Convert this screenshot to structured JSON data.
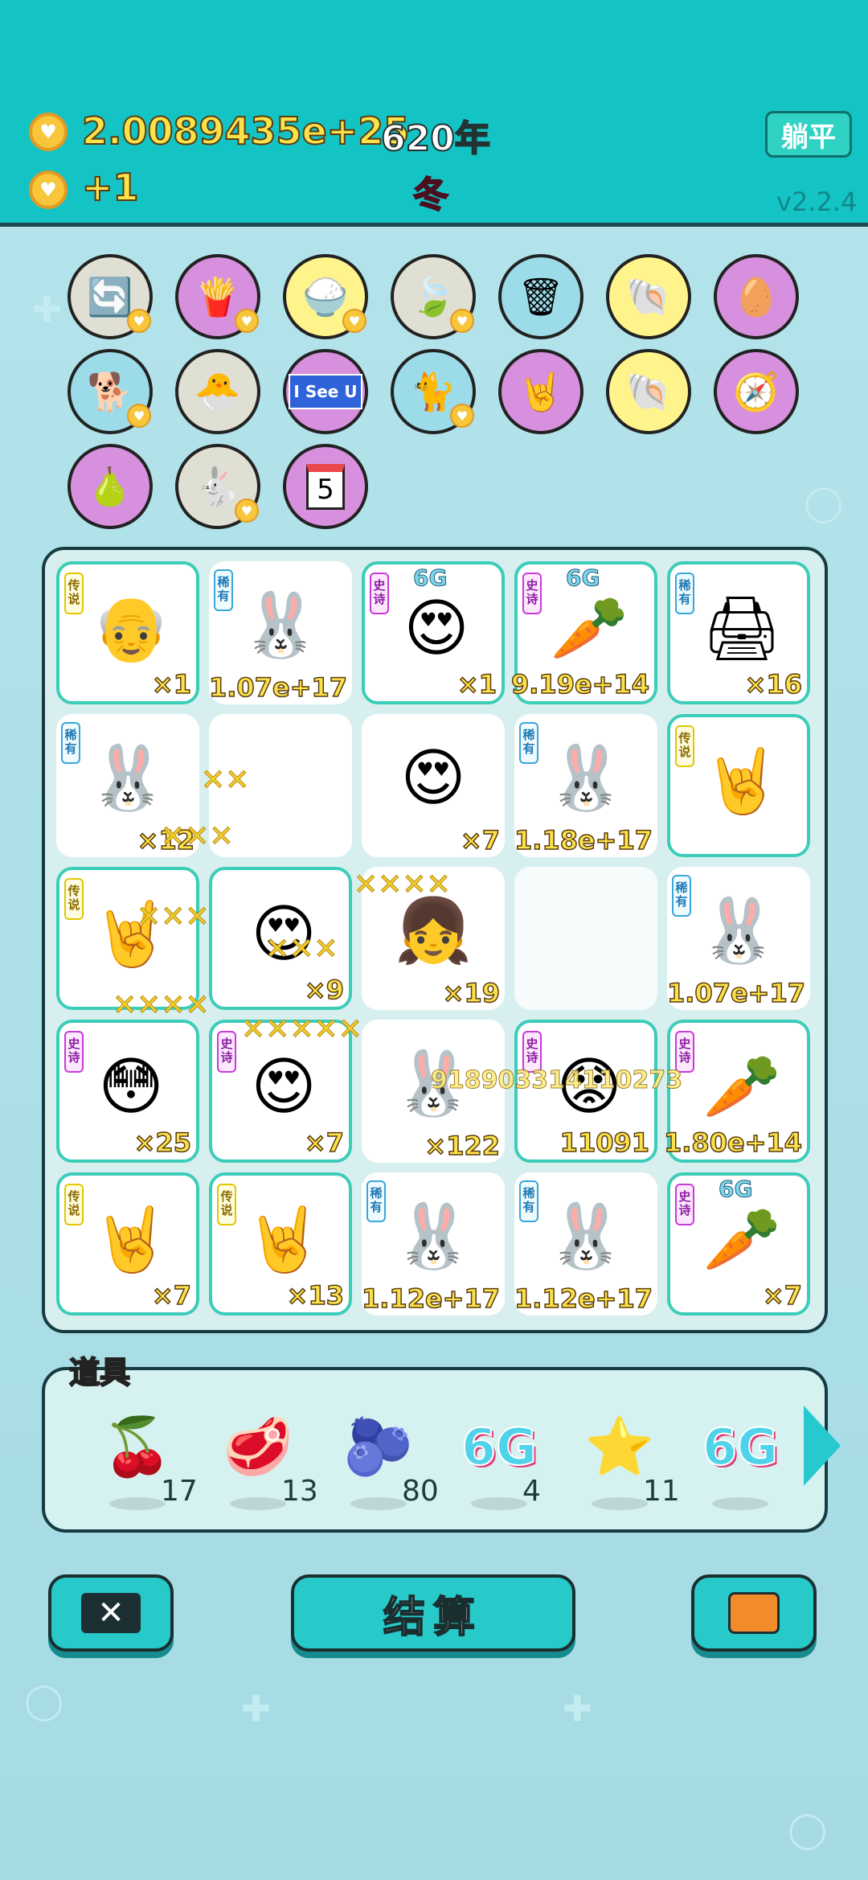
{
  "header": {
    "coins": "2.0089435e+25",
    "year": "620年",
    "rate": "+1",
    "season": "冬",
    "lie_flat_label": "躺平",
    "version": "v2.2.4"
  },
  "collection": [
    {
      "icon": "refresh-icon",
      "glyph": "🔄",
      "bg": "gray",
      "badge": true
    },
    {
      "icon": "fries-icon",
      "glyph": "🍟",
      "bg": "purple",
      "badge": true
    },
    {
      "icon": "rice-bowl-icon",
      "glyph": "🍚",
      "bg": "yellow",
      "badge": true
    },
    {
      "icon": "leaf-icon",
      "glyph": "🍃",
      "bg": "gray",
      "badge": true
    },
    {
      "icon": "trash-bag-icon",
      "glyph": "🗑",
      "bg": "blue",
      "badge": false
    },
    {
      "icon": "shell-icon",
      "glyph": "🐚",
      "bg": "yellow",
      "badge": false
    },
    {
      "icon": "egg-icon",
      "glyph": "🥚",
      "bg": "purple",
      "badge": false
    },
    {
      "icon": "dog-icon",
      "glyph": "🐕",
      "bg": "blue",
      "badge": true
    },
    {
      "icon": "chick-icon",
      "glyph": "🐣",
      "bg": "gray",
      "badge": false
    },
    {
      "icon": "i-see-u-sign-icon",
      "glyph": "I See U",
      "bg": "purple",
      "badge": false
    },
    {
      "icon": "cat-icon",
      "glyph": "🐈",
      "bg": "blue",
      "badge": true
    },
    {
      "icon": "rock-hand-icon",
      "glyph": "🤘",
      "bg": "purple",
      "badge": false
    },
    {
      "icon": "shell-icon",
      "glyph": "🐚",
      "bg": "yellow",
      "badge": false
    },
    {
      "icon": "compass-icon",
      "glyph": "🧭",
      "bg": "purple",
      "badge": false
    },
    {
      "icon": "grapefruit-icon",
      "glyph": "🍐",
      "bg": "purple",
      "badge": false
    },
    {
      "icon": "rabbit-icon",
      "glyph": "🐇",
      "bg": "gray",
      "badge": true
    },
    {
      "icon": "calendar-icon",
      "glyph": "5",
      "bg": "purple",
      "badge": false
    }
  ],
  "board": [
    {
      "tag": "传说",
      "tagType": "cs",
      "icon": "old-man-glasses-icon",
      "glyph": "👴",
      "count": "×1",
      "rare": true
    },
    {
      "tag": "稀有",
      "tagType": "xy",
      "icon": "rabbit-icon",
      "glyph": "🐰",
      "count": "1.07e+17",
      "rare": false
    },
    {
      "tag": "史诗",
      "tagType": "ss",
      "icon": "heart-eyes-face-icon",
      "glyph": "😍",
      "count": "×1",
      "rare": true,
      "top": "6G"
    },
    {
      "tag": "史诗",
      "tagType": "ss",
      "icon": "carrot-icon",
      "glyph": "🥕",
      "count": "9.19e+14",
      "rare": true,
      "top": "6G"
    },
    {
      "tag": "稀有",
      "tagType": "xy",
      "icon": "printer-icon",
      "glyph": "🖨",
      "count": "×16",
      "rare": true
    },
    {
      "tag": "稀有",
      "tagType": "xy",
      "icon": "rabbit-icon",
      "glyph": "🐰",
      "count": "×12",
      "rare": false
    },
    {
      "tag": "",
      "tagType": "",
      "icon": "sparkle-icon",
      "glyph": "",
      "count": "",
      "rare": false
    },
    {
      "tag": "",
      "tagType": "",
      "icon": "heart-eyes-man-icon",
      "glyph": "😍",
      "count": "×7",
      "rare": false
    },
    {
      "tag": "稀有",
      "tagType": "xy",
      "icon": "rabbit-icon",
      "glyph": "🐰",
      "count": "1.18e+17",
      "rare": false
    },
    {
      "tag": "传说",
      "tagType": "cs",
      "icon": "rock-hand-icon",
      "glyph": "🤘",
      "count": "",
      "rare": true
    },
    {
      "tag": "传说",
      "tagType": "cs",
      "icon": "rock-hand-icon",
      "glyph": "🤘",
      "count": "",
      "rare": true
    },
    {
      "tag": "",
      "tagType": "",
      "icon": "green-hat-face-icon",
      "glyph": "😍",
      "count": "×9",
      "rare": true
    },
    {
      "tag": "",
      "tagType": "",
      "icon": "girl-face-icon",
      "glyph": "👧",
      "count": "×19",
      "rare": false
    },
    {
      "tag": "",
      "tagType": "",
      "icon": "empty-slot",
      "glyph": "",
      "count": "",
      "rare": false
    },
    {
      "tag": "稀有",
      "tagType": "xy",
      "icon": "rabbit-icon",
      "glyph": "🐰",
      "count": "1.07e+17",
      "rare": false
    },
    {
      "tag": "史诗",
      "tagType": "ss",
      "icon": "blush-girl-icon",
      "glyph": "😳",
      "count": "×25",
      "rare": true
    },
    {
      "tag": "史诗",
      "tagType": "ss",
      "icon": "heart-eyes-girl-icon",
      "glyph": "😍",
      "count": "×7",
      "rare": true
    },
    {
      "tag": "",
      "tagType": "",
      "icon": "rabbit-icon",
      "glyph": "🐰",
      "count": "×122",
      "rare": false
    },
    {
      "tag": "史诗",
      "tagType": "ss",
      "icon": "sad-old-man-icon",
      "glyph": "😟",
      "count": "11091",
      "rare": true
    },
    {
      "tag": "史诗",
      "tagType": "ss",
      "icon": "carrot-icon",
      "glyph": "🥕",
      "count": "1.80e+14",
      "rare": true
    },
    {
      "tag": "传说",
      "tagType": "cs",
      "icon": "rock-hand-icon",
      "glyph": "🤘",
      "count": "×7",
      "rare": true
    },
    {
      "tag": "传说",
      "tagType": "cs",
      "icon": "rock-hand-icon",
      "glyph": "🤘",
      "count": "×13",
      "rare": true
    },
    {
      "tag": "稀有",
      "tagType": "xy",
      "icon": "rabbit-icon",
      "glyph": "🐰",
      "count": "1.12e+17",
      "rare": false
    },
    {
      "tag": "稀有",
      "tagType": "xy",
      "icon": "rabbit-icon",
      "glyph": "🐰",
      "count": "1.12e+17",
      "rare": false
    },
    {
      "tag": "史诗",
      "tagType": "ss",
      "icon": "carrot-icon",
      "glyph": "🥕",
      "count": "×7",
      "rare": true,
      "top": "6G"
    }
  ],
  "floating_number": "918903314110273",
  "tools": {
    "label": "道具",
    "items": [
      {
        "icon": "lychee-icon",
        "glyph": "🍒",
        "count": "17"
      },
      {
        "icon": "liver-icon",
        "glyph": "🥩",
        "count": "13"
      },
      {
        "icon": "blueberry-icon",
        "glyph": "🫐",
        "count": "80"
      },
      {
        "icon": "6g-icon",
        "glyph": "6G",
        "count": "4"
      },
      {
        "icon": "star-icon",
        "glyph": "⭐",
        "count": "11"
      },
      {
        "icon": "6g-icon",
        "glyph": "6G",
        "count": ""
      }
    ]
  },
  "buttons": {
    "settle_label": "结算"
  }
}
